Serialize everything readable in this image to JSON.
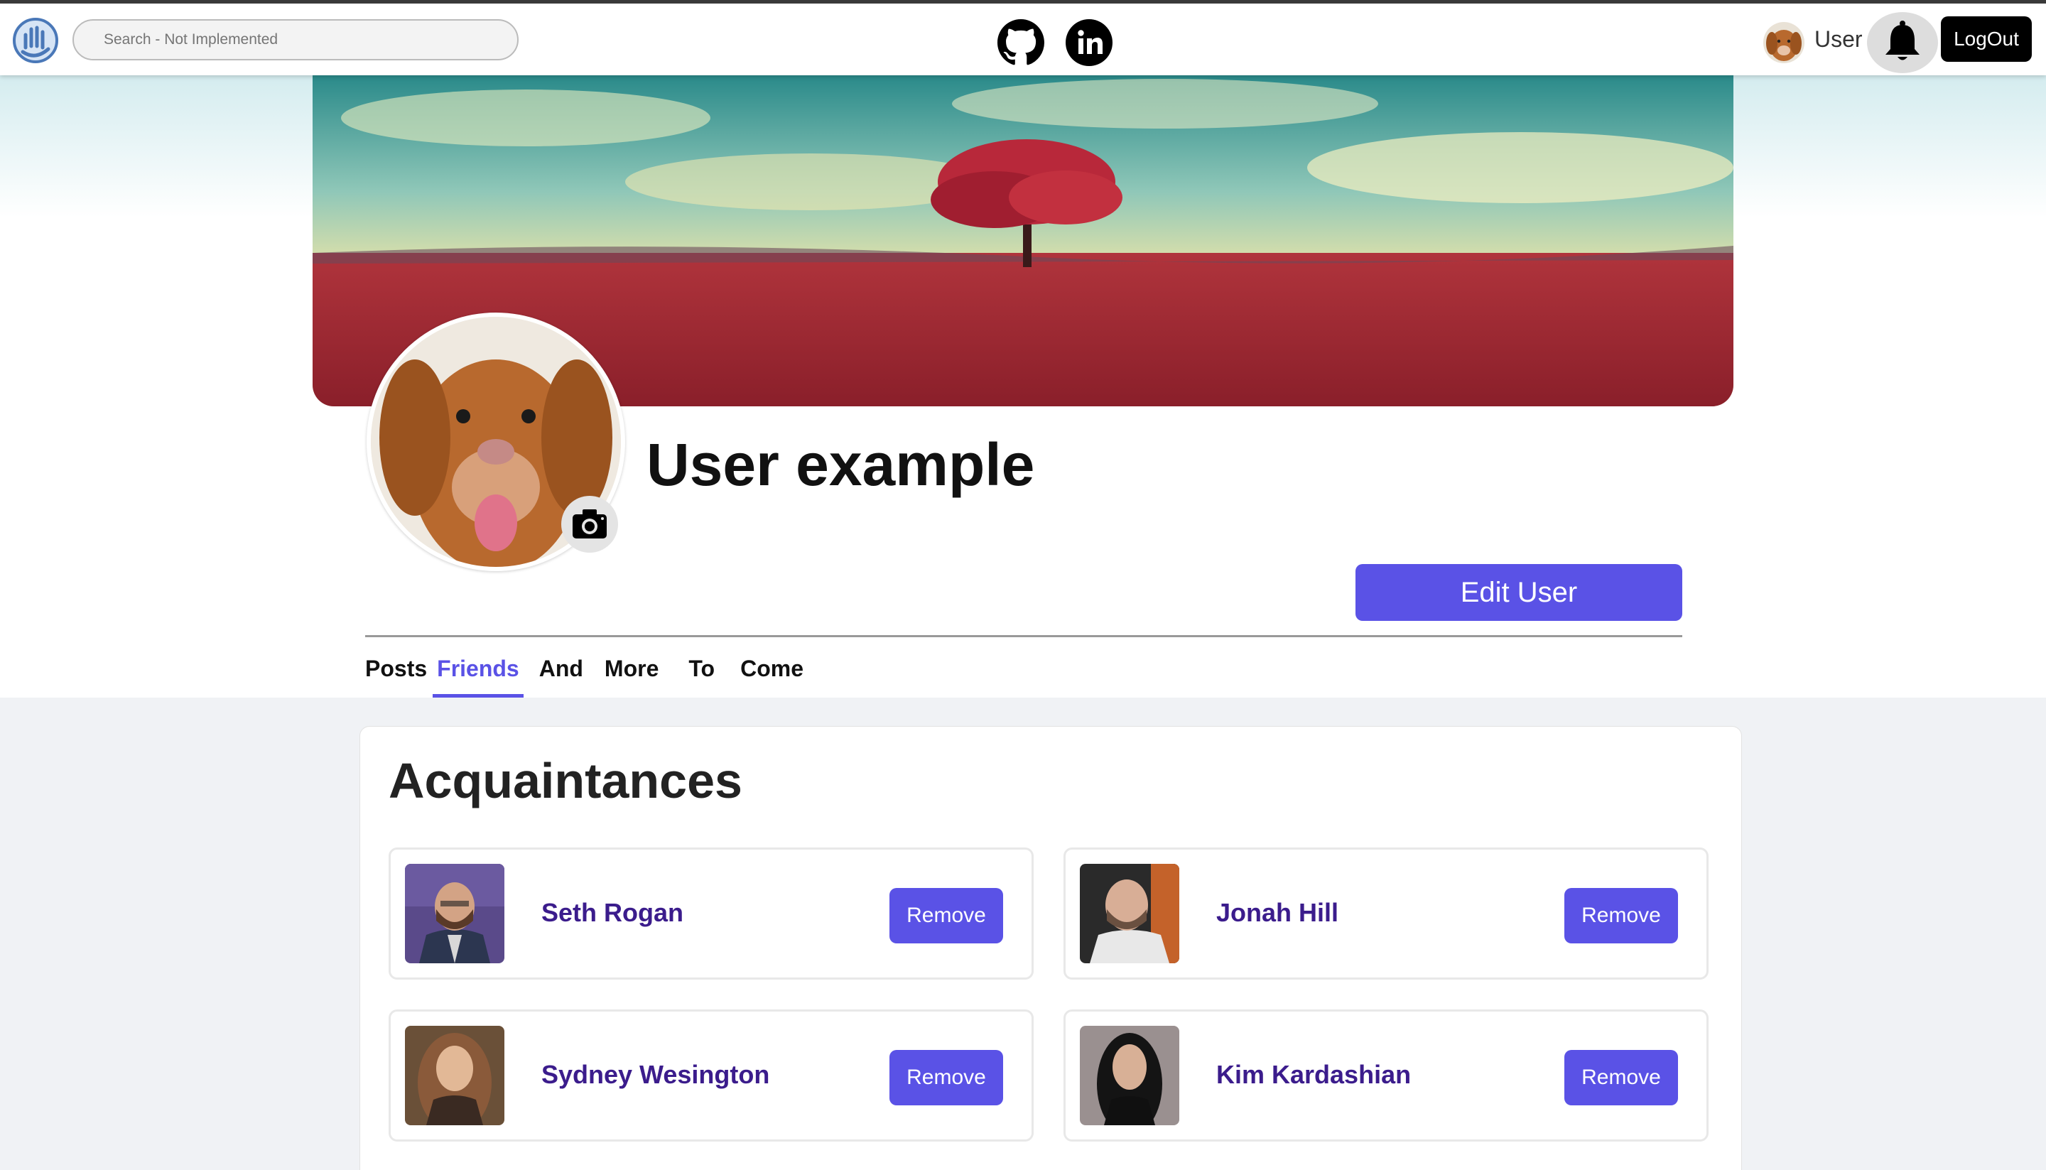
{
  "nav": {
    "search_placeholder": "Search - Not Implemented",
    "user_label": "User",
    "logout_label": "LogOut"
  },
  "profile": {
    "name": "User example",
    "edit_label": "Edit User"
  },
  "tabs": [
    {
      "label": "Posts",
      "active": false
    },
    {
      "label": "Friends",
      "active": true
    },
    {
      "label": "And",
      "active": false
    },
    {
      "label": "More",
      "active": false
    },
    {
      "label": "To",
      "active": false
    },
    {
      "label": "Come",
      "active": false
    }
  ],
  "acquaintances": {
    "title": "Acquaintances",
    "friends": [
      {
        "name": "Seth Rogan",
        "remove_label": "Remove"
      },
      {
        "name": "Jonah Hill",
        "remove_label": "Remove"
      },
      {
        "name": "Sydney Wesington",
        "remove_label": "Remove"
      },
      {
        "name": "Kim Kardashian",
        "remove_label": "Remove"
      }
    ]
  },
  "colors": {
    "accent": "#5a52e6",
    "friend_name": "#3b1c8c",
    "logout_bg": "#000000",
    "page_bg": "#f0f2f5"
  },
  "icons": {
    "logo": "hand-logo-icon",
    "github": "github-icon",
    "linkedin": "linkedin-icon",
    "bell": "bell-icon",
    "camera": "camera-icon"
  }
}
